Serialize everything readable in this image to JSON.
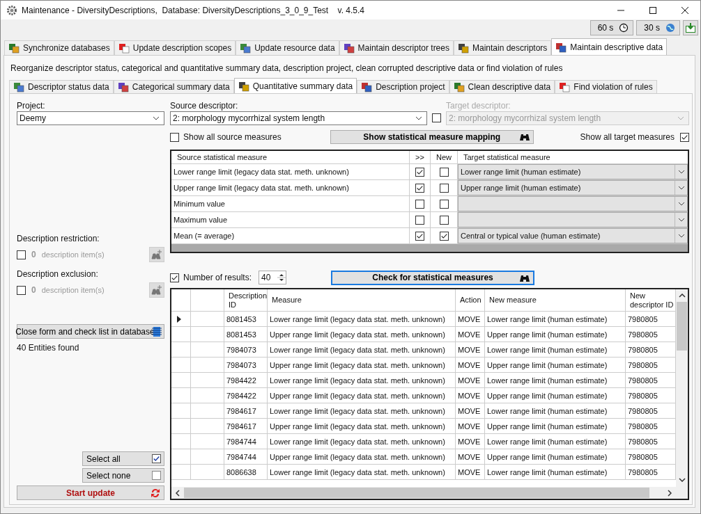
{
  "window": {
    "title": "Maintenance - DiversityDescriptions,  Database: DiversityDescriptions_3_0_9_Test    v. 4.5.4"
  },
  "toolbar": {
    "timers": [
      "60 s",
      "30 s"
    ]
  },
  "main_tabs": [
    {
      "label": "Synchronize databases",
      "selected": false
    },
    {
      "label": "Update description scopes",
      "selected": false
    },
    {
      "label": "Update resource data",
      "selected": false
    },
    {
      "label": "Maintain descriptor trees",
      "selected": false
    },
    {
      "label": "Maintain descriptors",
      "selected": false
    },
    {
      "label": "Maintain descriptive data",
      "selected": true
    }
  ],
  "description": "Reorganize descriptor status, categorical and quantitative summary data, description project, clean corrupted descriptive data or find violation of rules",
  "sub_tabs": [
    {
      "label": "Descriptor status data",
      "selected": false
    },
    {
      "label": "Categorical summary data",
      "selected": false
    },
    {
      "label": "Quantitative summary data",
      "selected": true
    },
    {
      "label": "Description project",
      "selected": false
    },
    {
      "label": "Clean descriptive data",
      "selected": false
    },
    {
      "label": "Find violation of rules",
      "selected": false
    }
  ],
  "project": {
    "label": "Project:",
    "value": "Deemy"
  },
  "source_descriptor": {
    "label": "Source descriptor:",
    "value": "2: morphology mycorrhizal system length"
  },
  "target_enabled": {
    "checked": false
  },
  "target_descriptor": {
    "label": "Target descriptor:",
    "value": "2: morphology mycorrhizal system length",
    "disabled": true
  },
  "show_all_source": {
    "label": "Show all source measures",
    "checked": false
  },
  "mapping_button": {
    "label": "Show statistical measure mapping"
  },
  "show_all_target": {
    "label": "Show all target measures",
    "checked": true
  },
  "mapping_table": {
    "columns": [
      "Source statistical measure",
      ">>",
      "New",
      "Target statistical measure"
    ],
    "rows": [
      {
        "source": "Lower range limit (legacy data stat. meth. unknown)",
        "transfer": true,
        "new": false,
        "target": "Lower range limit (human estimate)"
      },
      {
        "source": "Upper range limit (legacy data stat. meth. unknown)",
        "transfer": true,
        "new": false,
        "target": "Upper range limit (human estimate)"
      },
      {
        "source": "Minimum value",
        "transfer": false,
        "new": false
      },
      {
        "source": "Maximum value",
        "transfer": false,
        "new": false
      },
      {
        "source": "Mean (= average)",
        "transfer": true,
        "new": true,
        "target": "Central or typical value (human estimate)"
      }
    ]
  },
  "restriction": {
    "label": "Description restriction:",
    "checked": false,
    "count": "0",
    "text": "description item(s)"
  },
  "exclusion": {
    "label": "Description exclusion:",
    "checked": false,
    "count": "0",
    "text": "description item(s)"
  },
  "close_button": {
    "label": "Close form and check list in database"
  },
  "entities_found": "40 Entities found",
  "number_of_results": {
    "label": "Number of results:",
    "checked": true,
    "value": "40"
  },
  "check_button": {
    "label": "Check for statistical measures"
  },
  "results_table": {
    "columns": [
      "Description ID",
      "Measure",
      "Action",
      "New measure",
      "New descriptor ID"
    ],
    "rows": [
      {
        "current": true,
        "cells": [
          "8081453",
          "Lower range limit (legacy data stat. meth. unknown)",
          "MOVE",
          "Lower range limit (human estimate)",
          "7980805"
        ]
      },
      {
        "current": false,
        "cells": [
          "8081453",
          "Upper range limit (legacy data stat. meth. unknown)",
          "MOVE",
          "Upper range limit (human estimate)",
          "7980805"
        ]
      },
      {
        "current": false,
        "cells": [
          "7984073",
          "Lower range limit (legacy data stat. meth. unknown)",
          "MOVE",
          "Lower range limit (human estimate)",
          "7980805"
        ]
      },
      {
        "current": false,
        "cells": [
          "7984073",
          "Upper range limit (legacy data stat. meth. unknown)",
          "MOVE",
          "Upper range limit (human estimate)",
          "7980805"
        ]
      },
      {
        "current": false,
        "cells": [
          "7984422",
          "Lower range limit (legacy data stat. meth. unknown)",
          "MOVE",
          "Lower range limit (human estimate)",
          "7980805"
        ]
      },
      {
        "current": false,
        "cells": [
          "7984422",
          "Upper range limit (legacy data stat. meth. unknown)",
          "MOVE",
          "Upper range limit (human estimate)",
          "7980805"
        ]
      },
      {
        "current": false,
        "cells": [
          "7984617",
          "Lower range limit (legacy data stat. meth. unknown)",
          "MOVE",
          "Lower range limit (human estimate)",
          "7980805"
        ]
      },
      {
        "current": false,
        "cells": [
          "7984617",
          "Upper range limit (legacy data stat. meth. unknown)",
          "MOVE",
          "Upper range limit (human estimate)",
          "7980805"
        ]
      },
      {
        "current": false,
        "cells": [
          "7984744",
          "Lower range limit (legacy data stat. meth. unknown)",
          "MOVE",
          "Lower range limit (human estimate)",
          "7980805"
        ]
      },
      {
        "current": false,
        "cells": [
          "7984744",
          "Upper range limit (legacy data stat. meth. unknown)",
          "MOVE",
          "Upper range limit (human estimate)",
          "7980805"
        ]
      },
      {
        "current": false,
        "cells": [
          "8086638",
          "Lower range limit (legacy data stat. meth. unknown)",
          "MOVE",
          "Lower range limit (human estimate)",
          "7980805"
        ]
      }
    ]
  },
  "select_all": {
    "label": "Select all",
    "checked": true
  },
  "select_none": {
    "label": "Select none",
    "checked": false
  },
  "start_update": {
    "label": "Start update"
  }
}
